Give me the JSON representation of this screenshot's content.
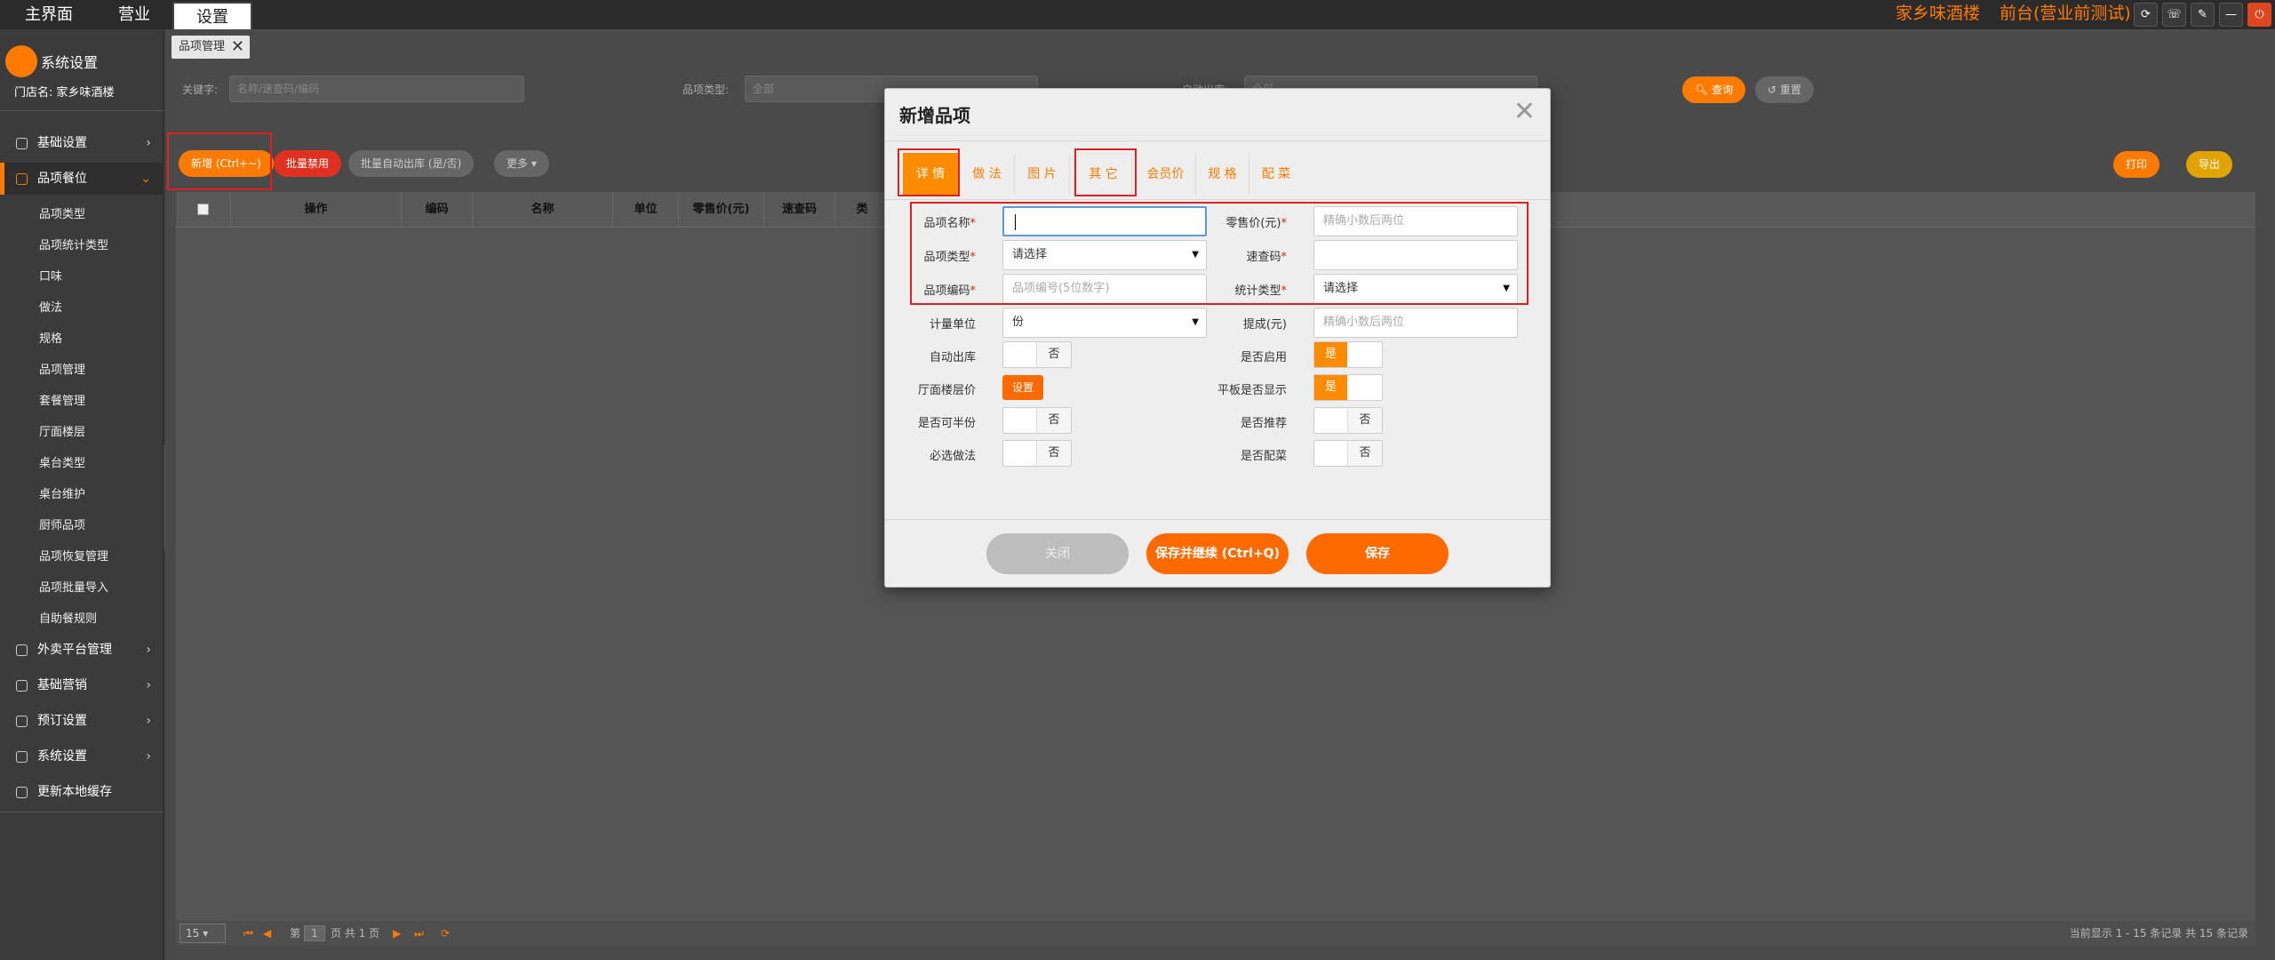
{
  "topbar": {
    "tabs": [
      "主界面",
      "营业",
      "设置"
    ],
    "brand": "家乡味酒楼",
    "mode": "前台(营业前测试)",
    "tools": [
      "refresh-icon",
      "phone-icon",
      "edit-icon",
      "minimize-icon",
      "power-icon"
    ]
  },
  "sidebar": {
    "title": "系统设置",
    "store": "门店名: 家乡味酒楼",
    "groups": [
      "基础设置",
      "品项餐位",
      "外卖平台管理",
      "基础营销",
      "预订设置",
      "系统设置",
      "更新本地缓存"
    ],
    "subitems": [
      "品项类型",
      "品项统计类型",
      "口味",
      "做法",
      "规格",
      "品项管理",
      "套餐管理",
      "厅面楼层",
      "桌台类型",
      "桌台维护",
      "厨师品项",
      "品项恢复管理",
      "品项批量导入",
      "自助餐规则"
    ]
  },
  "page": {
    "tab": "品项管理",
    "keyword_label": "关键字:",
    "keyword_placeholder": "名称/速查码/编码",
    "type_label": "品项类型:",
    "type_value": "全部",
    "auto_label": "自动出库:",
    "auto_value": "全部",
    "query": "查询",
    "reset": "重置",
    "new_btn": "新增 (Ctrl+~)",
    "disable_btn": "批量禁用",
    "batch_btn": "批量自动出库 (是/否)",
    "more_btn": "更多",
    "print": "打印",
    "export": "导出",
    "columns": [
      "操作",
      "编码",
      "名称",
      "单位",
      "零售价(元)",
      "速查码",
      "类"
    ],
    "pager": {
      "size": "15",
      "page_label": "第",
      "page": "1",
      "total": "页 共 1 页",
      "summary": "当前显示 1 - 15 条记录 共 15 条记录"
    }
  },
  "dialog": {
    "title": "新增品项",
    "tabs": [
      "详 情",
      "做 法",
      "图 片",
      "其 它",
      "会员价",
      "规 格",
      "配 菜"
    ],
    "fields": {
      "name_label": "品项名称",
      "price_label": "零售价(元)",
      "price_placeholder": "精确小数后两位",
      "type_label": "品项类型",
      "type_value": "请选择",
      "quick_label": "速查码",
      "code_label": "品项编码",
      "code_placeholder": "品项编号(5位数字)",
      "stat_label": "统计类型",
      "stat_value": "请选择",
      "unit_label": "计量单位",
      "unit_value": "份",
      "commission_label": "提成(元)",
      "commission_placeholder": "精确小数后两位",
      "auto_out_label": "自动出库",
      "enabled_label": "是否启用",
      "floor_price_label": "厅面楼层价",
      "floor_price_btn": "设置",
      "tablet_label": "平板是否显示",
      "half_label": "是否可半份",
      "recommend_label": "是否推荐",
      "must_label": "必选做法",
      "side_label": "是否配菜"
    },
    "toggle": {
      "yes": "是",
      "no": "否"
    },
    "buttons": {
      "close": "关闭",
      "save_continue": "保存并继续 (Ctrl+Q)",
      "save": "保存"
    }
  },
  "colors": {
    "accent": "#ff7a00",
    "highlight": "#e02020"
  }
}
